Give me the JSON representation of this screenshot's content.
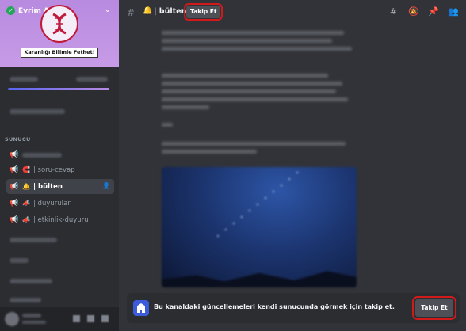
{
  "server": {
    "name": "Evrim Ağacı",
    "banner_text": "Karanlığı Bilimle Fethet!"
  },
  "sidebar": {
    "category_label": "SUNUCU",
    "channels": [
      {
        "name": "soru-cevap",
        "icon": "megaphone-icon",
        "emoji": "magnet-icon",
        "sep": "|"
      },
      {
        "name": "bülten",
        "icon": "bell-icon",
        "emoji": "",
        "sep": "|"
      },
      {
        "name": "duyurular",
        "icon": "megaphone-icon",
        "emoji": "loudspeaker-icon",
        "sep": "|"
      },
      {
        "name": "etkinlik-duyuru",
        "icon": "megaphone-icon",
        "emoji": "loudspeaker-icon",
        "sep": "|"
      }
    ]
  },
  "topbar": {
    "channel_name": "| bülten",
    "follow_label": "Takip Et"
  },
  "follow_bar": {
    "message": "Bu kanaldaki güncellemeleri kendi sunucunda görmek için takip et.",
    "button_label": "Takip Et"
  },
  "colors": {
    "accent": "#5865f2",
    "server_banner": "#c79be6",
    "highlight": "#d21a1a"
  }
}
